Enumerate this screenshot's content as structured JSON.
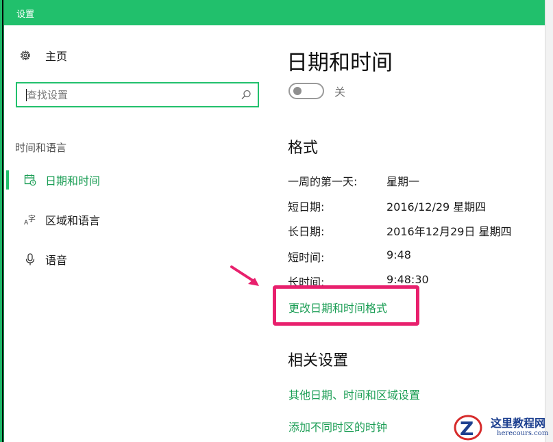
{
  "window": {
    "title": "设置"
  },
  "sidebar": {
    "home_label": "主页",
    "search_placeholder": "查找设置",
    "section_label": "时间和语言",
    "items": [
      {
        "label": "日期和时间",
        "icon": "calendar-clock-icon",
        "active": true
      },
      {
        "label": "区域和语言",
        "icon": "language-icon",
        "active": false
      },
      {
        "label": "语音",
        "icon": "microphone-icon",
        "active": false
      }
    ]
  },
  "main": {
    "title": "日期和时间",
    "toggle_state": "关",
    "format_heading": "格式",
    "format_rows": [
      {
        "key": "一周的第一天:",
        "value": "星期一"
      },
      {
        "key": "短日期:",
        "value": "2016/12/29 星期四"
      },
      {
        "key": "长日期:",
        "value": "2016年12月29日 星期四"
      },
      {
        "key": "短时间:",
        "value": "9:48"
      },
      {
        "key": "长时间:",
        "value": "9:48:30"
      }
    ],
    "change_format_link": "更改日期和时间格式",
    "related_heading": "相关设置",
    "related_links": [
      "其他日期、时间和区域设置",
      "添加不同时区的时钟"
    ]
  },
  "watermark": {
    "text": "这里教程网",
    "sub": "herecours.com"
  },
  "colors": {
    "accent": "#21c06c",
    "link": "#1a9d54",
    "highlight": "#e8206d"
  }
}
